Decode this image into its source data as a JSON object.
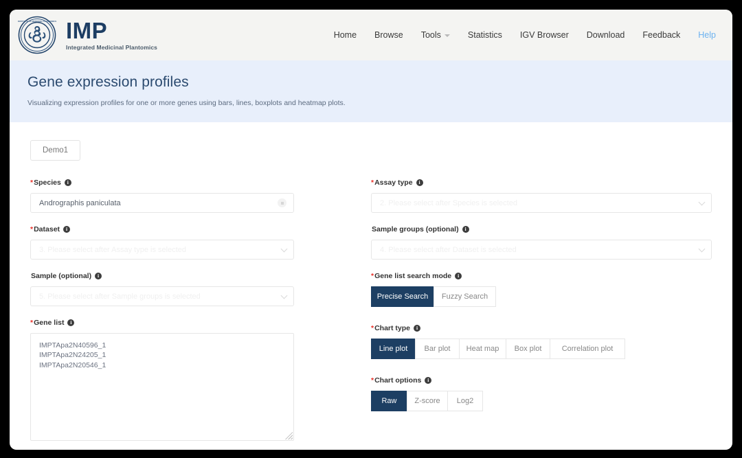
{
  "brand": {
    "title": "IMP",
    "subtitle": "Integrated Medicinal Plantomics",
    "logo_icon": "circular-seal-logo"
  },
  "nav": {
    "items": [
      {
        "label": "Home",
        "icon": null
      },
      {
        "label": "Browse",
        "icon": null
      },
      {
        "label": "Tools",
        "icon": "chevron-down-icon"
      },
      {
        "label": "Statistics",
        "icon": null
      },
      {
        "label": "IGV Browser",
        "icon": null
      },
      {
        "label": "Download",
        "icon": null
      },
      {
        "label": "Feedback",
        "icon": null
      },
      {
        "label": "Help",
        "icon": null
      }
    ]
  },
  "banner": {
    "title": "Gene expression profiles",
    "description": "Visualizing expression profiles for one or more genes using bars, lines, boxplots and heatmap plots."
  },
  "demo": {
    "label": "Demo1"
  },
  "form": {
    "species": {
      "label": "Species",
      "required": "*",
      "value": "Andrographis paniculata",
      "clear_icon": "clear-circle-icon"
    },
    "assay_type": {
      "label": "Assay type",
      "required": "*",
      "placeholder": "2. Please select after Species is selected",
      "value": "",
      "chevron_icon": "chevron-down-icon"
    },
    "dataset": {
      "label": "Dataset",
      "required": "*",
      "placeholder": "3. Please select after Assay type is selected",
      "value": "",
      "chevron_icon": "chevron-down-icon"
    },
    "sample_groups": {
      "label": "Sample groups (optional)",
      "required": "",
      "placeholder": "4. Please select after Dataset is selected",
      "value": "",
      "chevron_icon": "chevron-down-icon"
    },
    "sample": {
      "label": "Sample (optional)",
      "required": "",
      "placeholder": "5. Please select after Sample groups is selected",
      "value": "",
      "chevron_icon": "chevron-down-icon"
    },
    "gene_list_search_mode": {
      "label": "Gene list search mode",
      "required": "*",
      "options": [
        "Precise Search",
        "Fuzzy Search"
      ],
      "selected": "Precise Search"
    },
    "gene_list": {
      "label": "Gene list",
      "required": "*",
      "value": "IMPTApa2N40596_1\nIMPTApa2N24205_1\nIMPTApa2N20546_1",
      "resize_icon": "resize-grip-icon"
    },
    "chart_type": {
      "label": "Chart type",
      "required": "*",
      "options": [
        "Line plot",
        "Bar plot",
        "Heat map",
        "Box plot",
        "Correlation plot"
      ],
      "selected": "Line plot"
    },
    "chart_options": {
      "label": "Chart options",
      "required": "*",
      "options": [
        "Raw",
        "Z-score",
        "Log2"
      ],
      "selected": "Raw"
    }
  },
  "colors": {
    "accent_navy": "#1d3f63",
    "banner_bg": "#e8effb",
    "navbar_bg": "#f4f4f2",
    "required_red": "#e8322a",
    "help_link": "#6cb2f0"
  },
  "info_glyph": "i"
}
